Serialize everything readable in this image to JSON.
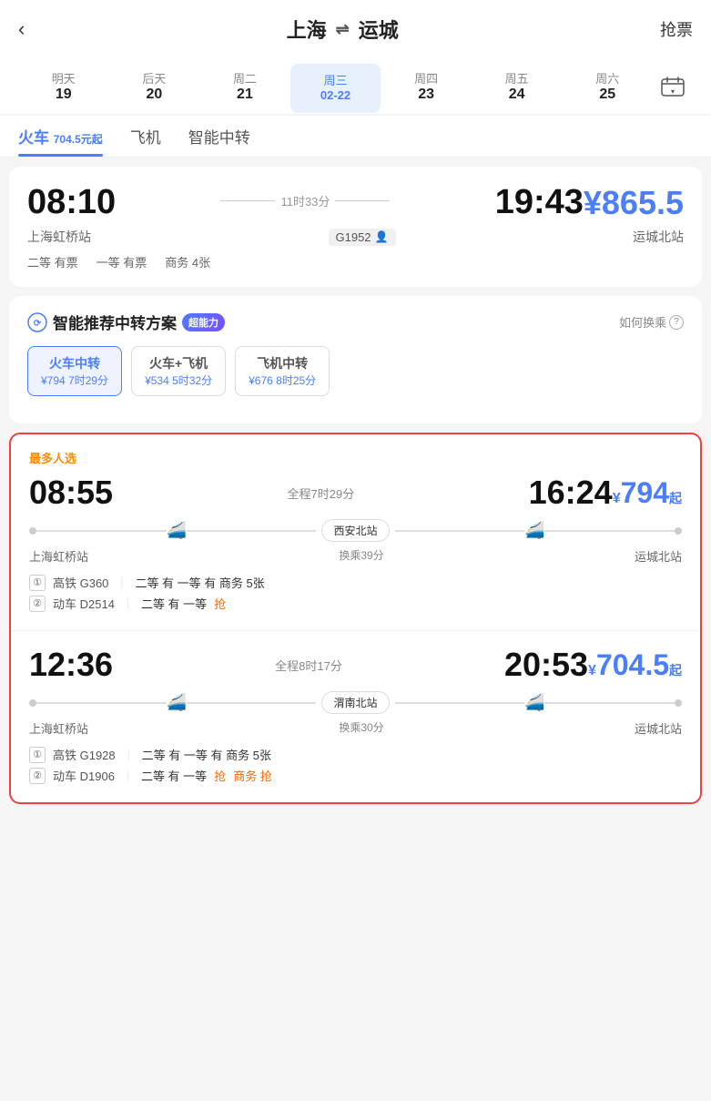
{
  "header": {
    "back_label": "‹",
    "origin": "上海",
    "destination": "运城",
    "arrow": "⇌",
    "grab_ticket": "抢票"
  },
  "date_tabs": [
    {
      "id": "tomorrow",
      "label": "明天",
      "date": "19",
      "active": false
    },
    {
      "id": "day_after",
      "label": "后天",
      "date": "20",
      "active": false
    },
    {
      "id": "tue",
      "label": "周二",
      "date": "21",
      "active": false
    },
    {
      "id": "wed",
      "label": "周三",
      "month_date": "02-22",
      "active": true
    },
    {
      "id": "thu",
      "label": "周四",
      "date": "23",
      "active": false
    },
    {
      "id": "fri",
      "label": "周五",
      "date": "24",
      "active": false
    },
    {
      "id": "sat",
      "label": "周六",
      "date": "25",
      "active": false
    }
  ],
  "transport_tabs": [
    {
      "id": "train",
      "label": "火车",
      "sub": "704.5元起",
      "active": true
    },
    {
      "id": "flight",
      "label": "飞机",
      "active": false
    },
    {
      "id": "smart",
      "label": "智能中转",
      "active": false
    }
  ],
  "direct_train": {
    "depart_time": "08:10",
    "arrive_time": "19:43",
    "duration": "11时33分",
    "train_no": "G1952",
    "depart_station": "上海虹桥站",
    "arrive_station": "运城北站",
    "price": "¥865.5",
    "seats": [
      {
        "label": "二等 有票"
      },
      {
        "label": "一等 有票"
      },
      {
        "label": "商务 4张"
      }
    ]
  },
  "smart_section": {
    "title": "智能推荐中转方案",
    "badge": "超能力",
    "how_to": "如何换乘",
    "transfer_types": [
      {
        "id": "train_transfer",
        "label": "火车中转",
        "price": "¥794 7时29分",
        "active": true
      },
      {
        "id": "train_flight",
        "label": "火车+飞机",
        "price": "¥534 5时32分",
        "active": false
      },
      {
        "id": "flight_transfer",
        "label": "飞机中转",
        "price": "¥676 8时25分",
        "active": false
      }
    ]
  },
  "transfer_results": [
    {
      "popular": true,
      "popular_label": "最多人选",
      "depart_time": "08:55",
      "arrive_time": "16:24",
      "duration": "全程7时29分",
      "price_prefix": "¥",
      "price": "794",
      "price_suffix": "起",
      "transfer_station": "西安北站",
      "depart_station": "上海虹桥站",
      "arrive_station": "运城北站",
      "transfer_wait": "换乘39分",
      "trains": [
        {
          "seq": "①",
          "train_no": "高铁 G360",
          "seats": "二等 有  一等 有  商务 5张"
        },
        {
          "seq": "②",
          "train_no": "动车 D2514",
          "seats": "二等 有  一等",
          "has_limited": true,
          "limited_text": "抢"
        }
      ]
    },
    {
      "popular": false,
      "depart_time": "12:36",
      "arrive_time": "20:53",
      "duration": "全程8时17分",
      "price_prefix": "¥",
      "price": "704.5",
      "price_suffix": "起",
      "transfer_station": "渭南北站",
      "depart_station": "上海虹桥站",
      "arrive_station": "运城北站",
      "transfer_wait": "换乘30分",
      "trains": [
        {
          "seq": "①",
          "train_no": "高铁 G1928",
          "seats": "二等 有  一等 有  商务 5张"
        },
        {
          "seq": "②",
          "train_no": "动车 D1906",
          "seats": "二等 有  一等",
          "has_limited": true,
          "limited_text": "抢",
          "has_business_limited": true,
          "business_limited_text": "商务 抢"
        }
      ]
    }
  ]
}
